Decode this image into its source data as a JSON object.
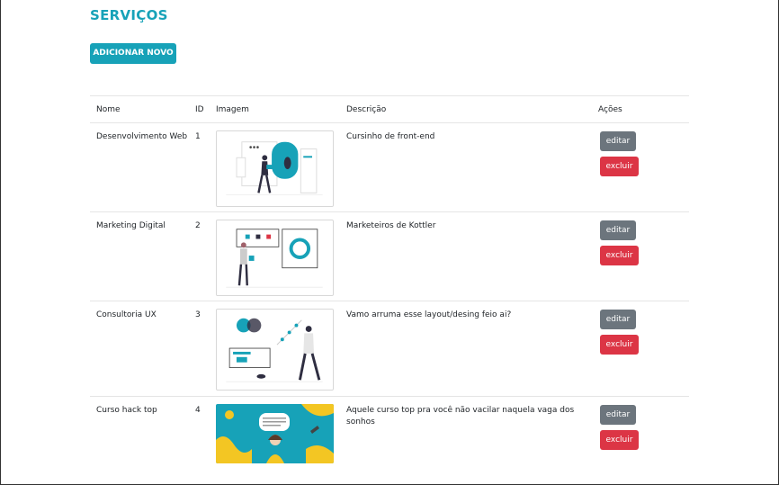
{
  "page": {
    "title": "SERVIÇOS",
    "add_button": "ADICIONAR NOVO"
  },
  "table": {
    "headers": {
      "nome": "Nome",
      "id": "ID",
      "imagem": "Imagem",
      "descricao": "Descrição",
      "acoes": "Ações"
    },
    "rows": [
      {
        "nome": "Desenvolvimento Web",
        "id": "1",
        "descricao": "Cursinho de front-end",
        "image_icon": "web-development-illustration",
        "edit": "editar",
        "delete": "excluir"
      },
      {
        "nome": "Marketing Digital",
        "id": "2",
        "descricao": "Marketeiros de Kottler",
        "image_icon": "analytics-dashboard-illustration",
        "edit": "editar",
        "delete": "excluir"
      },
      {
        "nome": "Consultoria UX",
        "id": "3",
        "descricao": "Vamo arruma esse layout/desing feio ai?",
        "image_icon": "ux-consulting-illustration",
        "edit": "editar",
        "delete": "excluir"
      },
      {
        "nome": "Curso hack top",
        "id": "4",
        "descricao": "Aquele curso top pra você não vacilar naquela vaga dos sonhos",
        "image_icon": "course-banner-illustration",
        "edit": "editar",
        "delete": "excluir"
      }
    ]
  },
  "colors": {
    "accent": "#17a2b8",
    "edit": "#6c757d",
    "delete": "#dc3545"
  }
}
